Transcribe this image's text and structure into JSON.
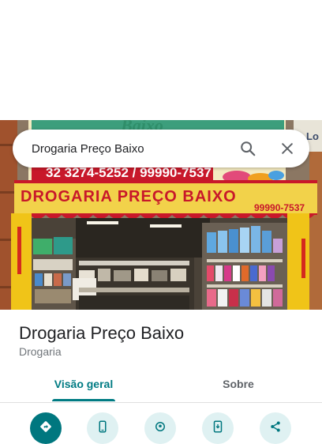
{
  "search": {
    "query": "Drogaria Preço Baixo"
  },
  "photo": {
    "sign_main": "DROGARIA PREÇO BAIXO",
    "sign_phone": "99990-7537",
    "upper_phones": "32 3274-5252 / 99990-7537",
    "upper_brand": "Baixo",
    "side_sign": "Lo"
  },
  "place": {
    "name": "Drogaria Preço Baixo",
    "category": "Drogaria"
  },
  "tabs": [
    {
      "label": "Visão geral",
      "selected": true
    },
    {
      "label": "Sobre",
      "selected": false
    }
  ],
  "actions": [
    {
      "icon": "directions-icon"
    },
    {
      "icon": "phone-icon"
    },
    {
      "icon": "nearby-icon"
    },
    {
      "icon": "send-to-phone-icon"
    },
    {
      "icon": "share-icon"
    }
  ],
  "colors": {
    "accent": "#007b83",
    "action_primary": "#00777f",
    "action_secondary": "#dff1f2",
    "sign_red": "#c8182a",
    "sign_yellow": "#f2d24a"
  }
}
